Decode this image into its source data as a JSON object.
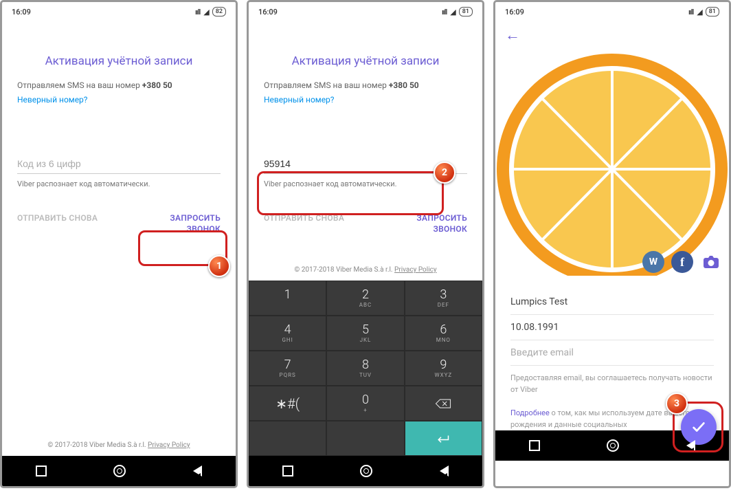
{
  "status": {
    "time": "16:09",
    "battery1": "82",
    "battery2": "81",
    "battery3": "81"
  },
  "activation": {
    "title": "Активация учётной записи",
    "sms_prefix": "Отправляем SMS на ваш номер ",
    "phone": "+380 50",
    "wrong_number": "Неверный номер?",
    "code_placeholder": "Код из 6 цифр",
    "code_value": "95914",
    "auto_text": "Viber распознает код автоматически.",
    "resend": "ОТПРАВИТЬ СНОВА",
    "request_call_l1": "ЗАПРОСИТЬ",
    "request_call_l2": "ЗВОНОК"
  },
  "footer": {
    "copyright": "© 2017-2018 Viber Media S.à r.l. ",
    "privacy": "Privacy Policy"
  },
  "keypad": {
    "k1": "1",
    "k2": "2",
    "k2l": "ABC",
    "k3": "3",
    "k3l": "DEF",
    "k4": "4",
    "k4l": "GHI",
    "k5": "5",
    "k5l": "JKL",
    "k6": "6",
    "k6l": "MNO",
    "k7": "7",
    "k7l": "PQRS",
    "k8": "8",
    "k8l": "TUV",
    "k9": "9",
    "k9l": "WXYZ",
    "sym": "∗#(",
    "k0": "0",
    "k0l": "+"
  },
  "profile": {
    "name": "Lumpics Test",
    "birthday": "10.08.1991",
    "email_placeholder": "Введите email",
    "email_hint": "Предоставляя email, вы соглашаетесь получать новости от Viber",
    "more_link": "Подробнее",
    "more_text": " о том, как мы используем дате вашего рождения и данные социальных",
    "vk_label": "W",
    "fb_label": "f"
  },
  "badges": {
    "b1": "1",
    "b2": "2",
    "b3": "3"
  }
}
